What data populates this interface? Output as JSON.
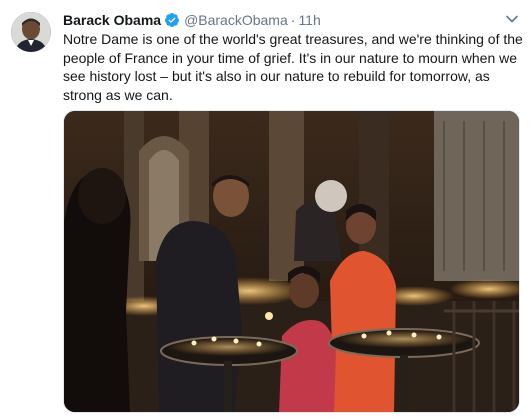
{
  "tweet": {
    "author_name": "Barack Obama",
    "handle": "@BarackObama",
    "separator": "·",
    "timestamp": "11h",
    "text": "Notre Dame is one of the world's great treasures, and we're thinking of the people of France in your time of grief. It's in our nature to mourn when we see history lost – but it's also in our nature to rebuild for tomorrow, as strong as we can.",
    "verified": true
  },
  "icons": {
    "verified": "verified-badge-icon",
    "menu": "chevron-down-icon"
  },
  "colors": {
    "verified_blue": "#1da1f2",
    "secondary_text": "#657786",
    "primary_text": "#14171a"
  }
}
